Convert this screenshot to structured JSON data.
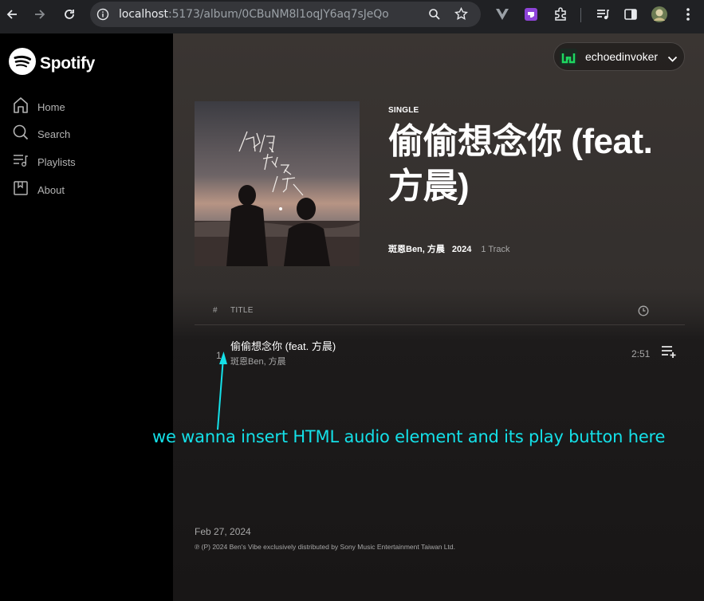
{
  "browser": {
    "url_host": "localhost",
    "url_path": ":5173/album/0CBuNM8l1oqJY6aq7sJeQo"
  },
  "sidebar": {
    "brand": "Spotify",
    "items": [
      {
        "label": "Home"
      },
      {
        "label": "Search"
      },
      {
        "label": "Playlists"
      },
      {
        "label": "About"
      }
    ]
  },
  "user": {
    "name": "echoedinvoker"
  },
  "album": {
    "type": "SINGLE",
    "title": "偷偷想念你 (feat. 方晨)",
    "artists": "斑恩Ben, 方晨",
    "year": "2024",
    "track_count": "1 Track",
    "release_date": "Feb 27, 2024",
    "copyright": "℗ (P) 2024 Ben's Vibe exclusively distributed by Sony Music Entertainment Taiwan Ltd."
  },
  "table": {
    "num_header": "#",
    "title_header": "TITLE"
  },
  "tracks": [
    {
      "number": "1",
      "title": "偷偷想念你 (feat. 方晨)",
      "artists": "斑恩Ben, 方晨",
      "duration": "2:51"
    }
  ],
  "annotation": {
    "text": "we wanna insert HTML audio element and its play button here",
    "color": "#14e0e8"
  },
  "colors": {
    "spotify_green": "#1ed760",
    "background": "#121212",
    "sidebar": "#000000"
  }
}
